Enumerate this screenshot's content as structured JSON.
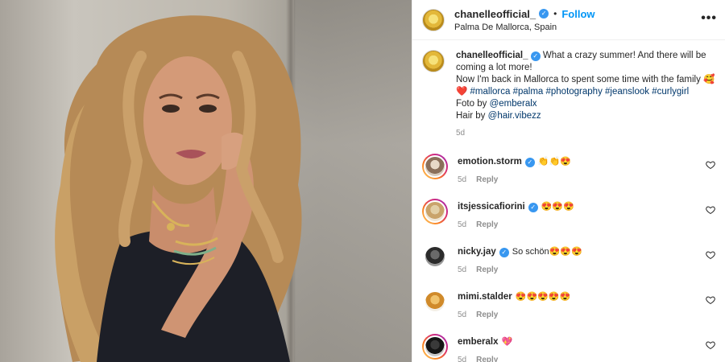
{
  "header": {
    "username": "chanelleofficial_",
    "follow_label": "Follow",
    "separator": "•",
    "location": "Palma De Mallorca, Spain",
    "more_label": "•••"
  },
  "caption": {
    "username": "chanelleofficial_",
    "line1": "What a crazy summer! And there will be coming a lot more!",
    "line2": "Now I'm back in Mallorca to spent some time with the family",
    "line2_emoji": "🥰",
    "line3_heart": "❤️",
    "hashtags": "#mallorca #palma #photography #jeanslook #curlygirl",
    "foto_prefix": "Foto by",
    "foto_handle": "@emberalx",
    "hair_prefix": "Hair by",
    "hair_handle": "@hair.vibezz",
    "time": "5d"
  },
  "comments": [
    {
      "username": "emotion.storm",
      "verified": true,
      "text": "👏👏😍",
      "time": "5d",
      "reply": "Reply"
    },
    {
      "username": "itsjessicafiorini",
      "verified": true,
      "text": "😍😍😍",
      "time": "5d",
      "reply": "Reply"
    },
    {
      "username": "nicky.jay",
      "verified": true,
      "text": "So schön😍😍😍",
      "time": "5d",
      "reply": "Reply"
    },
    {
      "username": "mimi.stalder",
      "verified": false,
      "text": "😍😍😍😍😍",
      "time": "5d",
      "reply": "Reply"
    },
    {
      "username": "emberalx",
      "verified": false,
      "text": "💖",
      "time": "5d",
      "reply": "Reply"
    }
  ],
  "colors": {
    "link_blue": "#0095f6",
    "hashtag": "#00376b",
    "verified": "#3897f0",
    "muted": "#8e8e8e"
  },
  "icons": {
    "verified": "verified-badge-icon",
    "like": "heart-outline-icon",
    "more": "more-options-icon"
  }
}
